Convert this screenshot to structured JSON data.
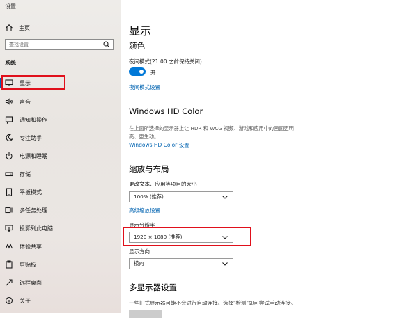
{
  "app_title": "设置",
  "sidebar": {
    "home_label": "主页",
    "search_placeholder": "查找设置",
    "section_label": "系统",
    "items": [
      {
        "label": "显示",
        "icon": "monitor-icon"
      },
      {
        "label": "声音",
        "icon": "speaker-icon"
      },
      {
        "label": "通知和操作",
        "icon": "notification-icon"
      },
      {
        "label": "专注助手",
        "icon": "moon-icon"
      },
      {
        "label": "电源和睡眠",
        "icon": "power-icon"
      },
      {
        "label": "存储",
        "icon": "storage-icon"
      },
      {
        "label": "平板模式",
        "icon": "tablet-icon"
      },
      {
        "label": "多任务处理",
        "icon": "multitask-icon"
      },
      {
        "label": "投影到此电脑",
        "icon": "project-icon"
      },
      {
        "label": "体验共享",
        "icon": "share-icon"
      },
      {
        "label": "剪贴板",
        "icon": "clipboard-icon"
      },
      {
        "label": "远程桌面",
        "icon": "remote-desktop-icon"
      },
      {
        "label": "关于",
        "icon": "info-icon"
      }
    ],
    "active_index": 0
  },
  "main": {
    "page_title": "显示",
    "color_section": {
      "heading": "颜色",
      "night_light_label": "夜间模式(21:00 之前保持关闭)",
      "toggle_state": "开",
      "night_light_settings_link": "夜间模式设置"
    },
    "hdr_section": {
      "heading": "Windows HD Color",
      "description": "在上面所选择的显示器上让 HDR 和 WCG 视频、游戏和应用中的画面更明亮、更生动。",
      "link": "Windows HD Color 设置"
    },
    "scale_section": {
      "heading": "缩放与布局",
      "scale_label": "更改文本、应用等项目的大小",
      "scale_value": "100% (推荐)",
      "advanced_link": "高级缩放设置",
      "resolution_label": "显示分辨率",
      "resolution_value": "1920 × 1080 (推荐)",
      "orientation_label": "显示方向",
      "orientation_value": "横向"
    },
    "multi_display_section": {
      "heading": "多显示器设置",
      "description": "一些旧式显示器可能不会进行自动连接。选择\"检测\"即可尝试手动连接。"
    }
  },
  "colors": {
    "accent": "#0078d7",
    "link": "#0063b1",
    "highlight_red": "#e0101b"
  }
}
